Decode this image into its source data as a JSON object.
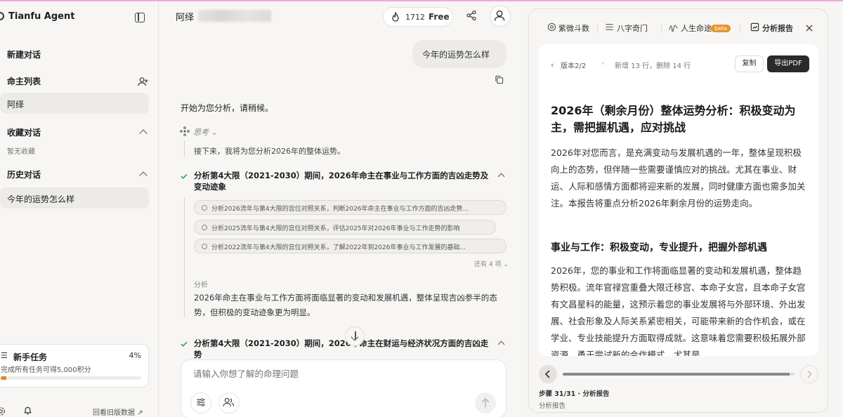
{
  "sidebar": {
    "title": "Tianfu Agent",
    "new_chat": "新建对话",
    "client_list": "命主列表",
    "client_item": "阿绎",
    "favorites": "收藏对话",
    "favorites_empty": "暂无收藏",
    "history": "历史对话",
    "history_item": "今年的运势怎么样",
    "task": {
      "title": "新手任务",
      "percent_label": "4%",
      "percent": 0.04,
      "subtitle": "完成所有任务可得5,000积分"
    },
    "footer_link": "回看旧版数据"
  },
  "header": {
    "name": "阿绎",
    "credits": "1712",
    "plan": "Free"
  },
  "chat": {
    "user_message": "今年的运势怎么样",
    "reply_intro": "开始为您分析，请稍候。",
    "thinking_label": "思考",
    "thinking_text": "接下来，我将为您分析2026年的整体运势。",
    "step1_title": "分析第4大限（2021-2030）期间，2026年命主在事业与工作方面的吉凶走势及变动迹象",
    "tool_calls": [
      "分析2026流年与第4大限的宫位对照关系，判断2026年命主在事业与工作方面的吉凶走势...",
      "分析2025流年与第4大限的宫位对照关系，评估2025年对2026年事业与工作走势的影响",
      "分析2022流年与第4大限的宫位对照关系，了解2022年到2026年事业与工作发展的基础..."
    ],
    "more_items": "还有 4 项",
    "analysis_label": "分析",
    "analysis_text": "2026年命主在事业与工作方面将面临显著的变动和发展机遇，整体呈现吉凶参半的态势，但积极的变动迹象更为明显。",
    "step2_title": "分析第4大限（2021-2030）期间，2026年命主在财运与经济状况方面的吉凶走势",
    "input_placeholder": "请输入你想了解的命理问题"
  },
  "panel": {
    "tabs": [
      "紫微斗数",
      "八字奇门",
      "人生命途",
      "分析报告"
    ],
    "beta": "beta",
    "version": "版本2/2",
    "diff": "新增 13 行，删除 14 行",
    "copy_btn": "复制",
    "pdf_btn": "导出PDF",
    "report_title": "2026年（剩余月份）整体运势分析：积极变动为主，需把握机遇，应对挑战",
    "report_intro": "2026年对您而言，是充满变动与发展机遇的一年，整体呈现积极向上的态势，但伴随一些需要谨慎应对的挑战。尤其在事业、财运、人际和感情方面都将迎来新的发展，同时健康方面也需多加关注。本报告将重点分析2026年剩余月份的运势走向。",
    "section_title": "事业与工作：积极变动，专业提升，把握外部机遇",
    "section_text": "2026年，您的事业和工作将面临显著的变动和发展机遇，整体趋势积极。流年官禄宫重叠大限迁移宫、本命子女宫，且本命子女宫有文昌星科的能量，这预示着您的事业发展将与外部环境、外出发展、社会形象及人际关系紧密相关，可能带来新的合作机会，或在学业、专业技能提升方面取得成就。这意味着您需要积极拓展外部资源，勇于尝试新的合作模式，尤其是",
    "progress": 0.98,
    "step_label": "步骤 31/31 · 分析报告",
    "step_sub": "分析报告"
  }
}
